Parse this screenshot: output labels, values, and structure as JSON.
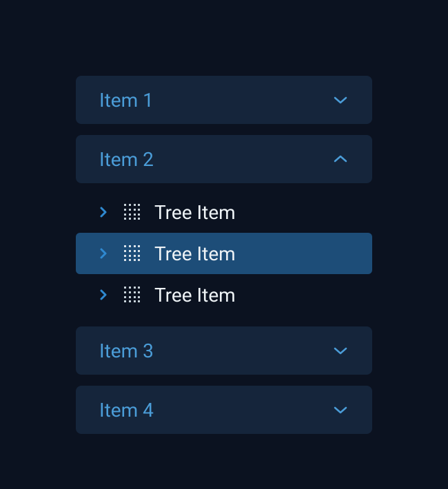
{
  "accordion": {
    "items": [
      {
        "label": "Item 1",
        "expanded": false
      },
      {
        "label": "Item 2",
        "expanded": true,
        "children": [
          {
            "label": "Tree Item",
            "selected": false
          },
          {
            "label": "Tree Item",
            "selected": true
          },
          {
            "label": "Tree Item",
            "selected": false
          }
        ]
      },
      {
        "label": "Item 3",
        "expanded": false
      },
      {
        "label": "Item 4",
        "expanded": false
      }
    ]
  },
  "icons": {
    "chevron_down": "chevron-down-icon",
    "chevron_up": "chevron-up-icon",
    "chevron_right": "chevron-right-icon",
    "drag_handle": "drag-handle-icon"
  }
}
